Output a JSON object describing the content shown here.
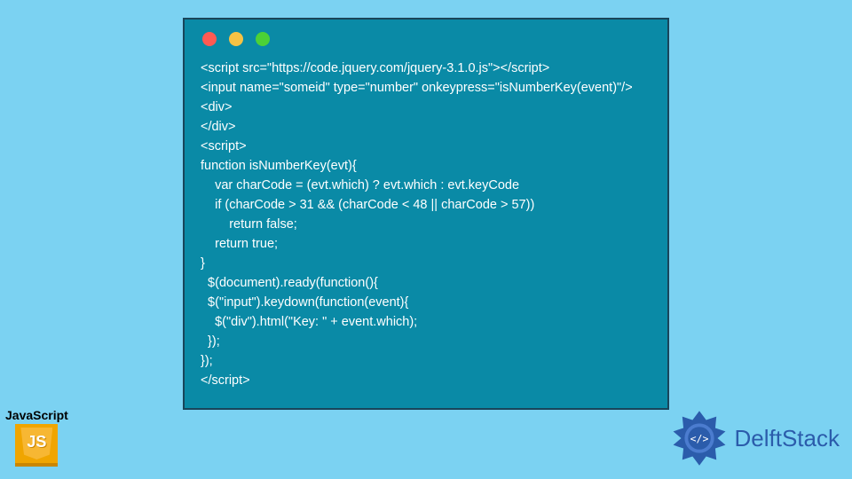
{
  "window_controls": {
    "red": "#ff5a52",
    "yellow": "#f6c244",
    "green": "#4cd137"
  },
  "code_lines": [
    "<script src=\"https://code.jquery.com/jquery-3.1.0.js\"></script>",
    "<input name=\"someid\" type=\"number\" onkeypress=\"isNumberKey(event)\"/>",
    "<div>",
    "</div>",
    "<script>",
    "function isNumberKey(evt){",
    "    var charCode = (evt.which) ? evt.which : evt.keyCode",
    "    if (charCode > 31 && (charCode < 48 || charCode > 57))",
    "        return false;",
    "    return true;",
    "}",
    "  $(document).ready(function(){",
    "  $(\"input\").keydown(function(event){",
    "    $(\"div\").html(\"Key: \" + event.which);",
    "  });",
    "});",
    "</script>"
  ],
  "js_badge": {
    "label": "JavaScript",
    "icon_text": "JS"
  },
  "brand": {
    "name": "DelftStack"
  }
}
